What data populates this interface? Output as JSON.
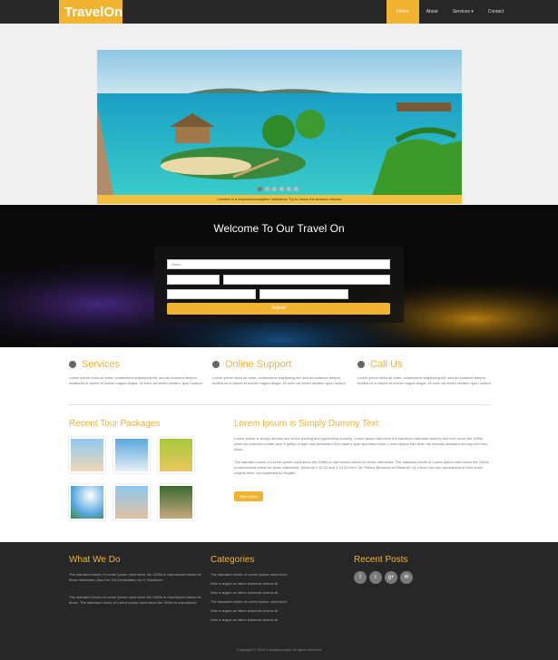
{
  "header": {
    "logo": "TravelOn",
    "nav": [
      "Home",
      "About",
      "Services ▾",
      "Contact"
    ]
  },
  "slider": {
    "caption": "Camera is a responsive/adaptive slideshow. Try to resize the browser window",
    "dot_count": 6,
    "active_dot": 0
  },
  "search": {
    "title": "Welcome To Our Travel On",
    "name_placeholder": "Name",
    "submit_label": "Submit"
  },
  "features": [
    {
      "title": "Services",
      "icon": "search-icon",
      "text": "Lorem ipsum dolor sit amet, consectetur adipisicing elit, sed do eiusmod tempor incididunt ut labore et dolore magna aliqua. Ut enim ad minim veniam, quis nostrud."
    },
    {
      "title": "Online Support",
      "icon": "support-icon",
      "text": "Lorem ipsum dolor sit amet, consectetur adipisicing elit, sed do eiusmod tempor incididunt ut labore et dolore magna aliqua. Ut enim ad minim veniam, quis nostrud."
    },
    {
      "title": "Call Us",
      "icon": "phone-icon",
      "text": "Lorem ipsum dolor sit amet, consectetur adipisicing elit, sed do eiusmod tempor incididunt ut labore et dolore magna aliqua. Ut enim ad minim veniam, quis nostrud."
    }
  ],
  "tours": {
    "title": "Recent Tour Packages"
  },
  "about": {
    "title": "Lorem Ipsum is Simply Dummy Text",
    "p1": "Lorem Ipsum is simply dummy text of the printing and typesetting industry. Lorem Ipsum has been the industry's standard dummy text ever since the 1500s, when an unknown printer took a galley of type and scrambled it to make a type specimen book. Lorem Ipsum has been the industry standard dummy text ever since.",
    "p2": "The standard chunk of Lorem Ipsum used since the 1500s is reproduced below for those interested. The standard chunk of Lorem Ipsum used since the 1500s is reproduced below for those interested. Sections 1.10.32 and 1.10.33 from \"de Finibus Bonorum et Malorum\" by Cicero are also reproduced in their exact original form, accompanied by English.",
    "button": "Read More"
  },
  "footer": {
    "what_title": "What We Do",
    "what_p1": "The standard chunk of Lorem Ipsum used since the 1500s is reproduced below for those interested. Also the 1914 translation by H. Rackham.",
    "what_p2": "The standard chunk of Lorem Ipsum used since the 1500s is reproduced below for those. The standard chunk of Lorem Ipsum used since the 1500s is reproduced.",
    "cat_title": "Categories",
    "categories": [
      "The standard chunk of Lorem Ipsum used since",
      "Duis a augue ac libero euismod viverra sit",
      "Duis a augue ac libero euismod viverra sit",
      "The standard chunk of Lorem Ipsum used since",
      "Duis a augue ac libero euismod viverra sit",
      "Duis a augue ac libero euismod viverra sit"
    ],
    "posts_title": "Recent Posts",
    "social": [
      "f",
      "t",
      "g+",
      "✉"
    ],
    "copyright": "Copyright © 2016 Company name All rights reserved"
  },
  "colors": {
    "accent": "#f1b430",
    "dark": "#272727"
  }
}
